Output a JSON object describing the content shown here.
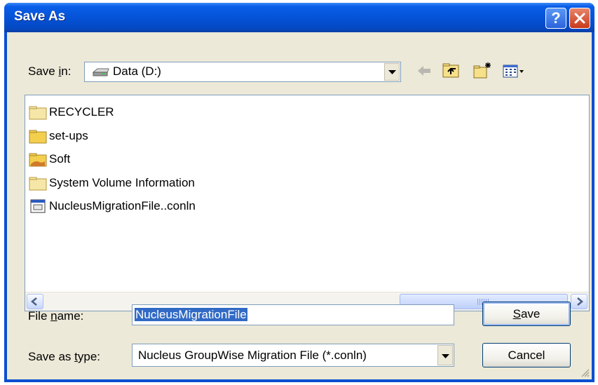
{
  "window": {
    "title": "Save As",
    "help_label": "?"
  },
  "savein": {
    "label_pre": "Save ",
    "label_key": "i",
    "label_post": "n:",
    "value": "Data (D:)",
    "drive_icon": "drive-icon"
  },
  "toolbar": {
    "back_icon": "back-arrow-icon",
    "up_icon": "up-folder-icon",
    "new_folder_icon": "new-folder-icon",
    "views_icon": "views-menu-icon"
  },
  "files": [
    {
      "name": "RECYCLER",
      "icon": "folder-icon"
    },
    {
      "name": "set-ups",
      "icon": "folder-icon"
    },
    {
      "name": "Soft",
      "icon": "shared-folder-icon"
    },
    {
      "name": "System Volume Information",
      "icon": "folder-icon"
    },
    {
      "name": "NucleusMigrationFile..conln",
      "icon": "file-icon"
    }
  ],
  "filename": {
    "label_pre": "File ",
    "label_key": "n",
    "label_post": "ame:",
    "value": "NucleusMigrationFile"
  },
  "filetype": {
    "label_pre": "Save as ",
    "label_key": "t",
    "label_post": "ype:",
    "value": "Nucleus GroupWise Migration File (*.conln)"
  },
  "buttons": {
    "save_key": "S",
    "save_rest": "ave",
    "cancel": "Cancel"
  },
  "colors": {
    "title_bar": "#0553d8",
    "face": "#ece9d8",
    "selection": "#316ac5",
    "close_button": "#c8391a"
  }
}
